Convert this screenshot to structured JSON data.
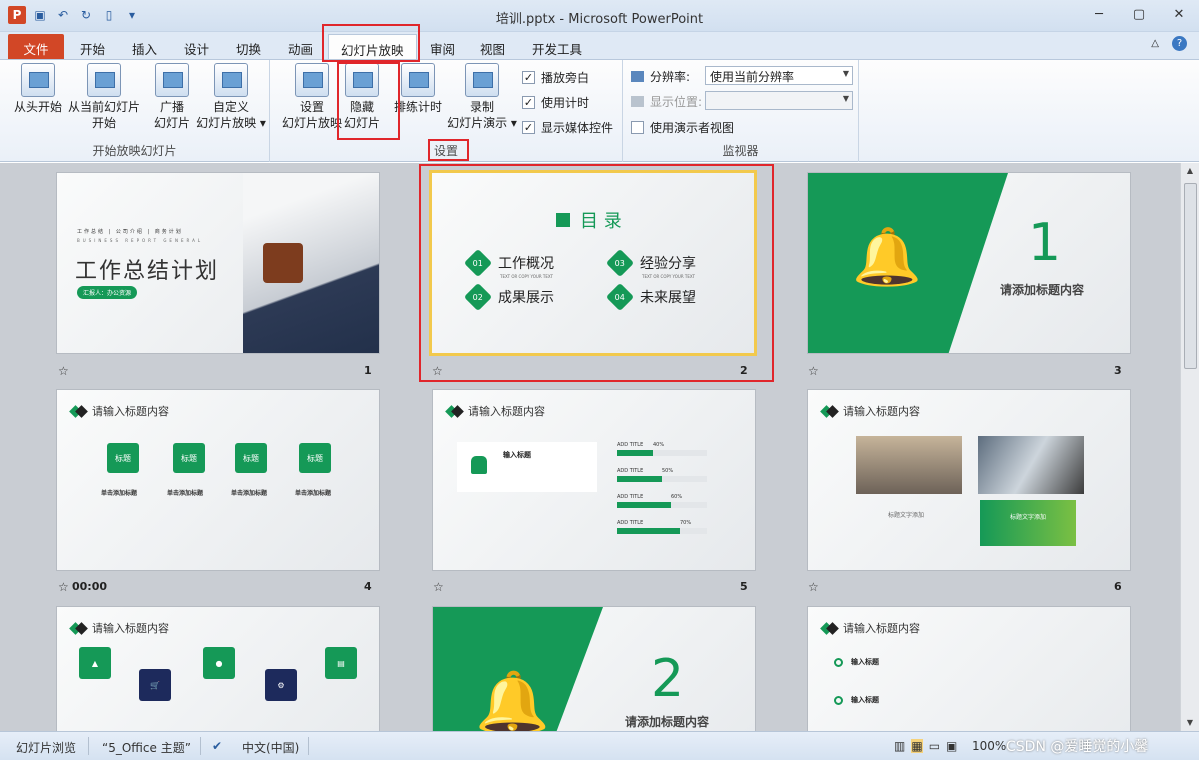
{
  "window": {
    "title": "培训.pptx - Microsoft PowerPoint",
    "app_icon": "P"
  },
  "tabs": [
    "文件",
    "开始",
    "插入",
    "设计",
    "切换",
    "动画",
    "幻灯片放映",
    "审阅",
    "视图",
    "开发工具"
  ],
  "ribbon": {
    "groups": {
      "start": "开始放映幻灯片",
      "setup": "设置",
      "monitor": "监视器"
    },
    "buttons": {
      "from_start": "从头开始",
      "from_current_1": "从当前幻灯片",
      "from_current_2": "开始",
      "broadcast_1": "广播",
      "broadcast_2": "幻灯片",
      "custom_1": "自定义",
      "custom_2": "幻灯片放映 ▾",
      "setup_1": "设置",
      "setup_2": "幻灯片放映",
      "hide_1": "隐藏",
      "hide_2": "幻灯片",
      "rehearse": "排练计时",
      "record_1": "录制",
      "record_2": "幻灯片演示 ▾"
    },
    "checks": {
      "narration": "播放旁白",
      "timings": "使用计时",
      "media": "显示媒体控件",
      "presenter": "使用演示者视图"
    },
    "resolution_label": "分辨率:",
    "resolution_value": "使用当前分辨率",
    "show_on_label": "显示位置:",
    "show_on_value": ""
  },
  "slides": {
    "s1": {
      "num": "1",
      "sub": "工作总结 | 公司介绍 | 商务计划",
      "sub2": "BUSINESS REPORT GENERAL",
      "title": "工作总结计划",
      "pill": "汇报人：办公资源"
    },
    "s2": {
      "num": "2",
      "title": "目 录",
      "items": [
        [
          "01",
          "工作概况"
        ],
        [
          "02",
          "成果展示"
        ],
        [
          "03",
          "经验分享"
        ],
        [
          "04",
          "未来展望"
        ]
      ],
      "caption": "TEXT OR COPY YOUR TEXT"
    },
    "s3": {
      "num": "3",
      "big": "1",
      "text": "请添加标题内容"
    },
    "s4": {
      "num": "4",
      "timing": "00:00",
      "header": "请输入标题内容",
      "box": "标题",
      "label": "单击添加标题"
    },
    "s5": {
      "num": "5",
      "header": "请输入标题内容",
      "input_title": "输入标题",
      "bar_label": "ADD TITLE",
      "bars": [
        {
          "label": "ADD TITLE",
          "value": 40
        },
        {
          "label": "ADD TITLE",
          "value": 50
        },
        {
          "label": "ADD TITLE",
          "value": 60
        },
        {
          "label": "ADD TITLE",
          "value": 70
        }
      ]
    },
    "s6": {
      "num": "6",
      "header": "请输入标题内容",
      "caption": "标题文字添加",
      "green": "标题文字添加"
    },
    "s7": {
      "header": "请输入标题内容"
    },
    "s8": {
      "big": "2",
      "text": "请添加标题内容"
    },
    "s9": {
      "header": "请输入标题内容",
      "item": "输入标题"
    }
  },
  "statusbar": {
    "view": "幻灯片浏览",
    "theme": "“5_Office 主题”",
    "lang": "中文(中国)",
    "zoom": "100%",
    "watermark": "CSDN @爱睡觉的小馨"
  },
  "colors": {
    "accent": "#159957",
    "highlight": "#e0262b"
  }
}
